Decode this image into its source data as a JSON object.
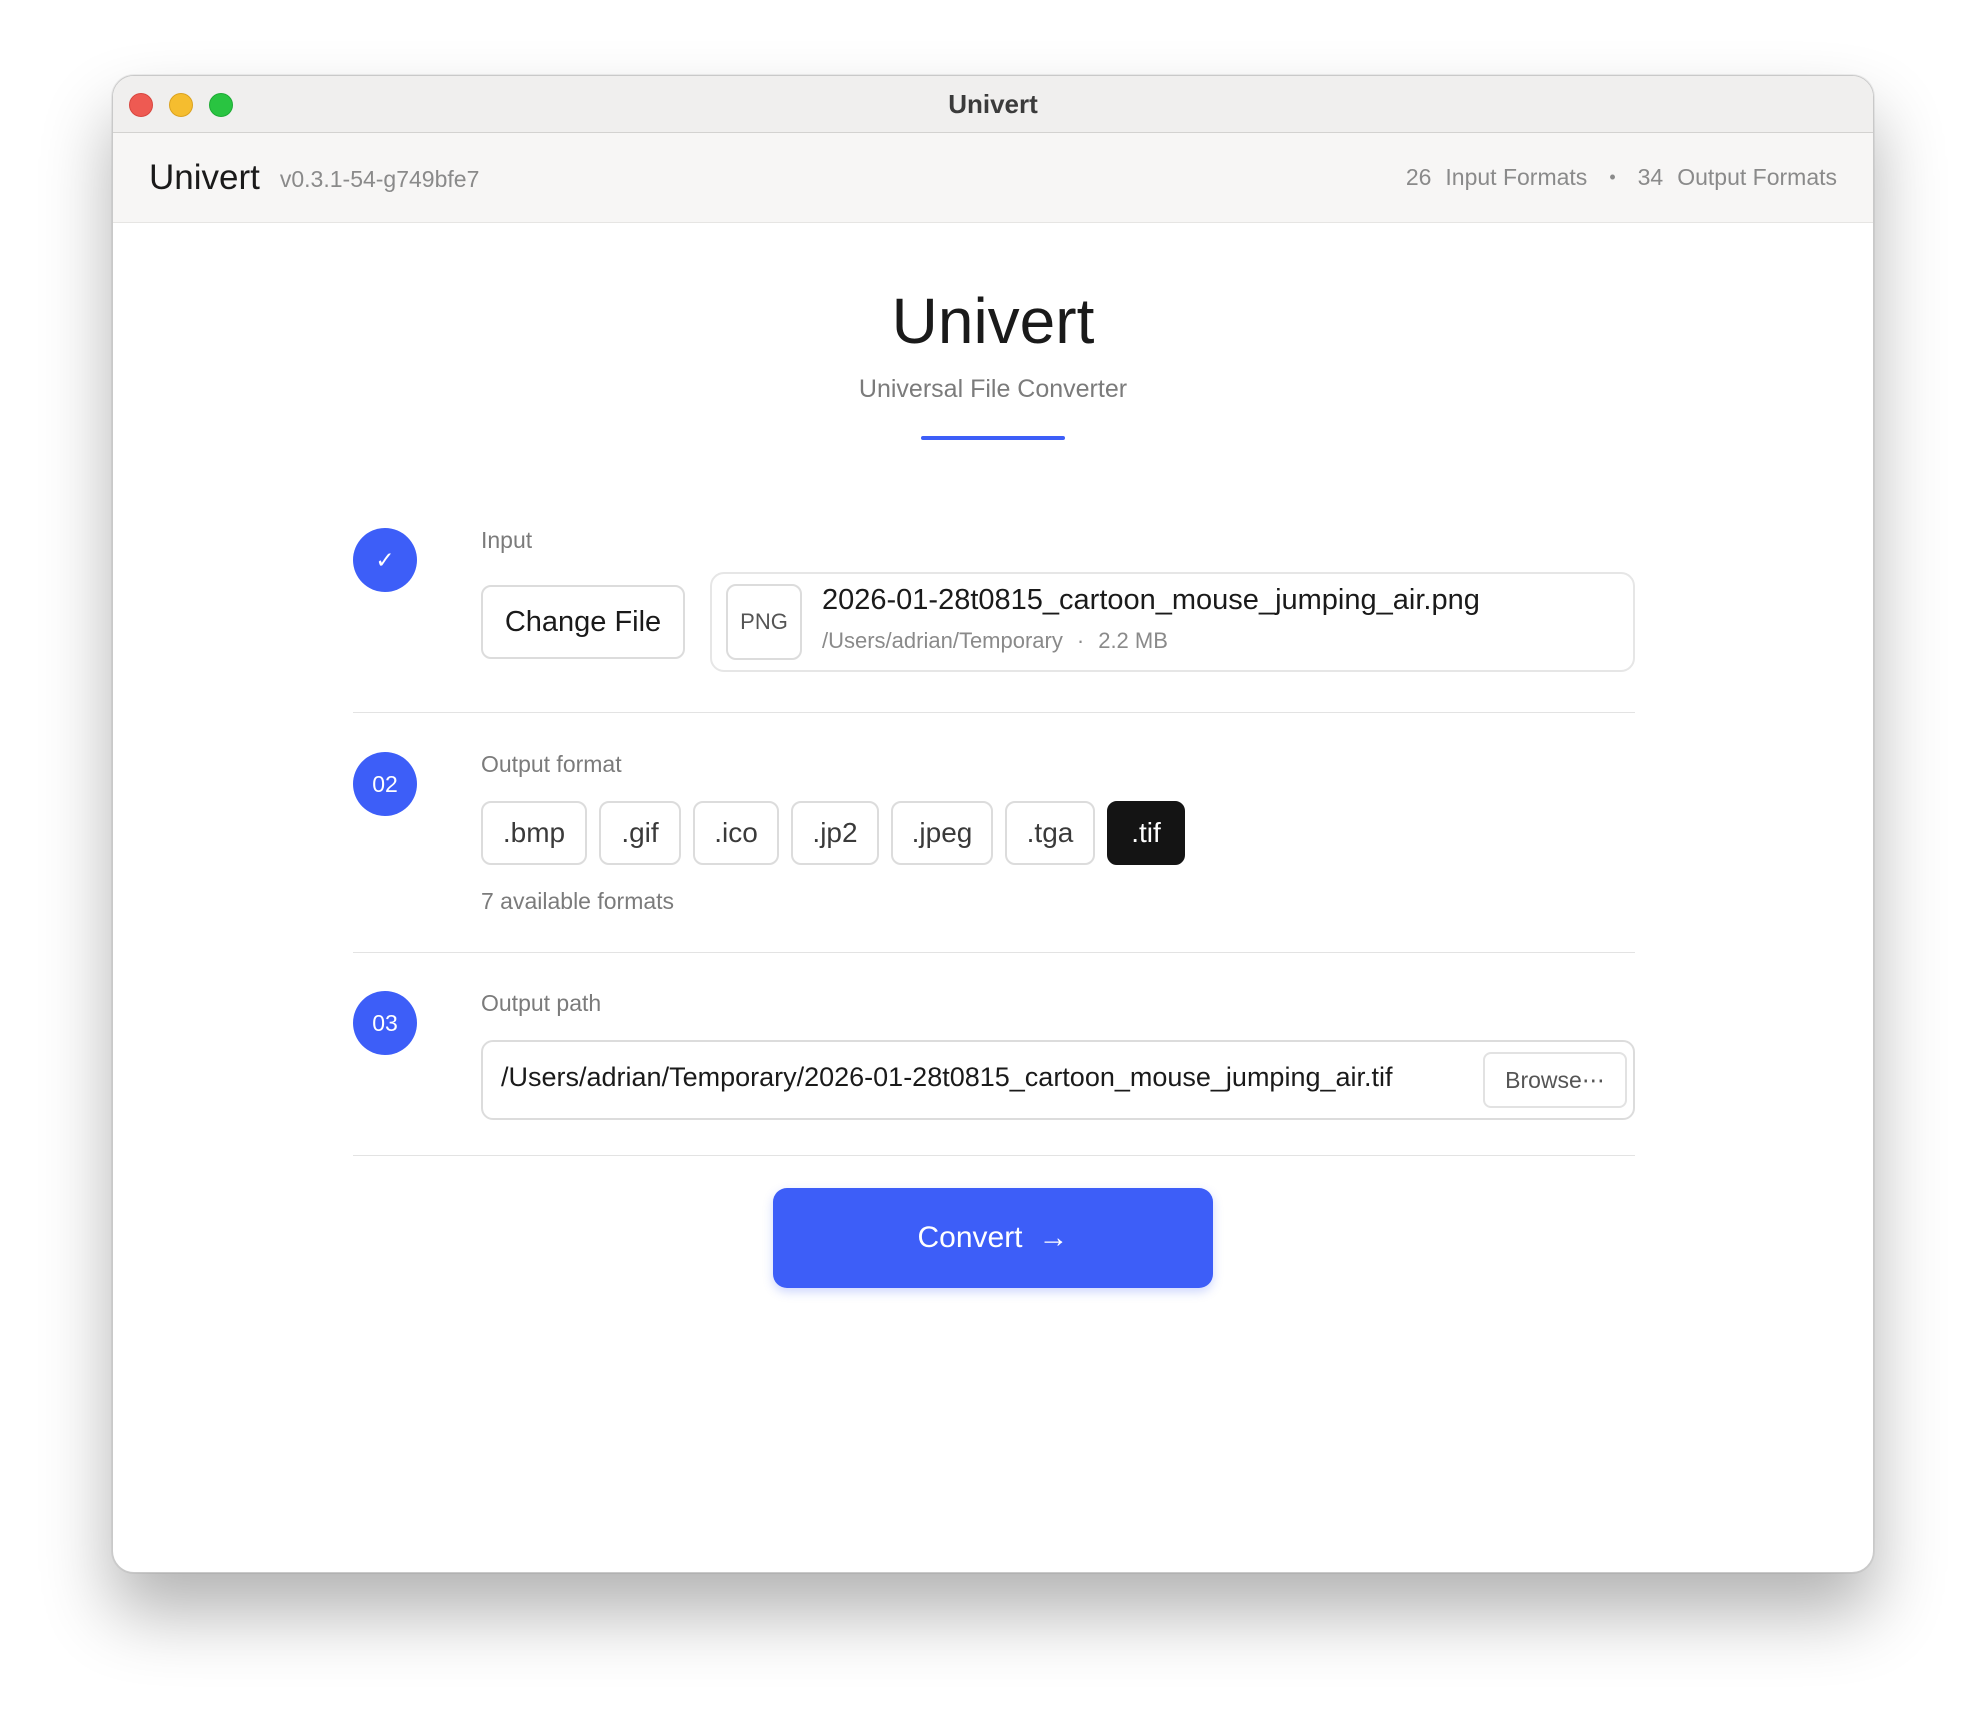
{
  "window": {
    "title": "Univert"
  },
  "appbar": {
    "name": "Univert",
    "version": "v0.3.1-54-g749bfe7",
    "input_formats_count": "26",
    "input_formats_label": "Input Formats",
    "separator": "•",
    "output_formats_count": "34",
    "output_formats_label": "Output Formats"
  },
  "hero": {
    "title": "Univert",
    "subtitle": "Universal File Converter"
  },
  "step1": {
    "badge": "✓",
    "label": "Input",
    "change_button": "Change File",
    "file": {
      "type": "PNG",
      "name": "2026-01-28t0815_cartoon_mouse_jumping_air.png",
      "directory": "/Users/adrian/Temporary",
      "separator": "·",
      "size": "2.2 MB"
    }
  },
  "step2": {
    "badge": "02",
    "label": "Output format",
    "formats": [
      ".bmp",
      ".gif",
      ".ico",
      ".jp2",
      ".jpeg",
      ".tga",
      ".tif"
    ],
    "selected": ".tif",
    "count_text": "7 available formats"
  },
  "step3": {
    "badge": "03",
    "label": "Output path",
    "path_value": "/Users/adrian/Temporary/2026-01-28t0815_cartoon_mouse_jumping_air.tif",
    "browse_label": "Browse⋯"
  },
  "convert": {
    "label": "Convert",
    "arrow": "→"
  },
  "colors": {
    "accent": "#3d5ef8",
    "selected_format": "#141414"
  }
}
